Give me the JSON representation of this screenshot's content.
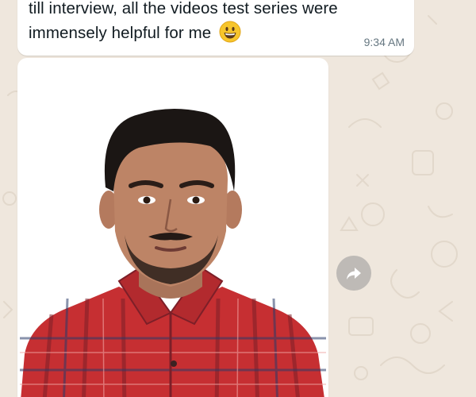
{
  "message": {
    "text_line1": "till interview, all the videos test series were",
    "text_line2": "immensely helpful for me",
    "emoji": "grinning-face-emoji",
    "time": "9:34 AM"
  },
  "photo": {
    "subject": "profile photo of a man in a red plaid shirt"
  },
  "actions": {
    "forward_icon": "forward-icon"
  },
  "colors": {
    "chat_background": "#efe7dd",
    "bubble": "#ffffff",
    "time_text": "#667781",
    "shirt_red": "#c62f32",
    "forward_button": "#969696"
  }
}
